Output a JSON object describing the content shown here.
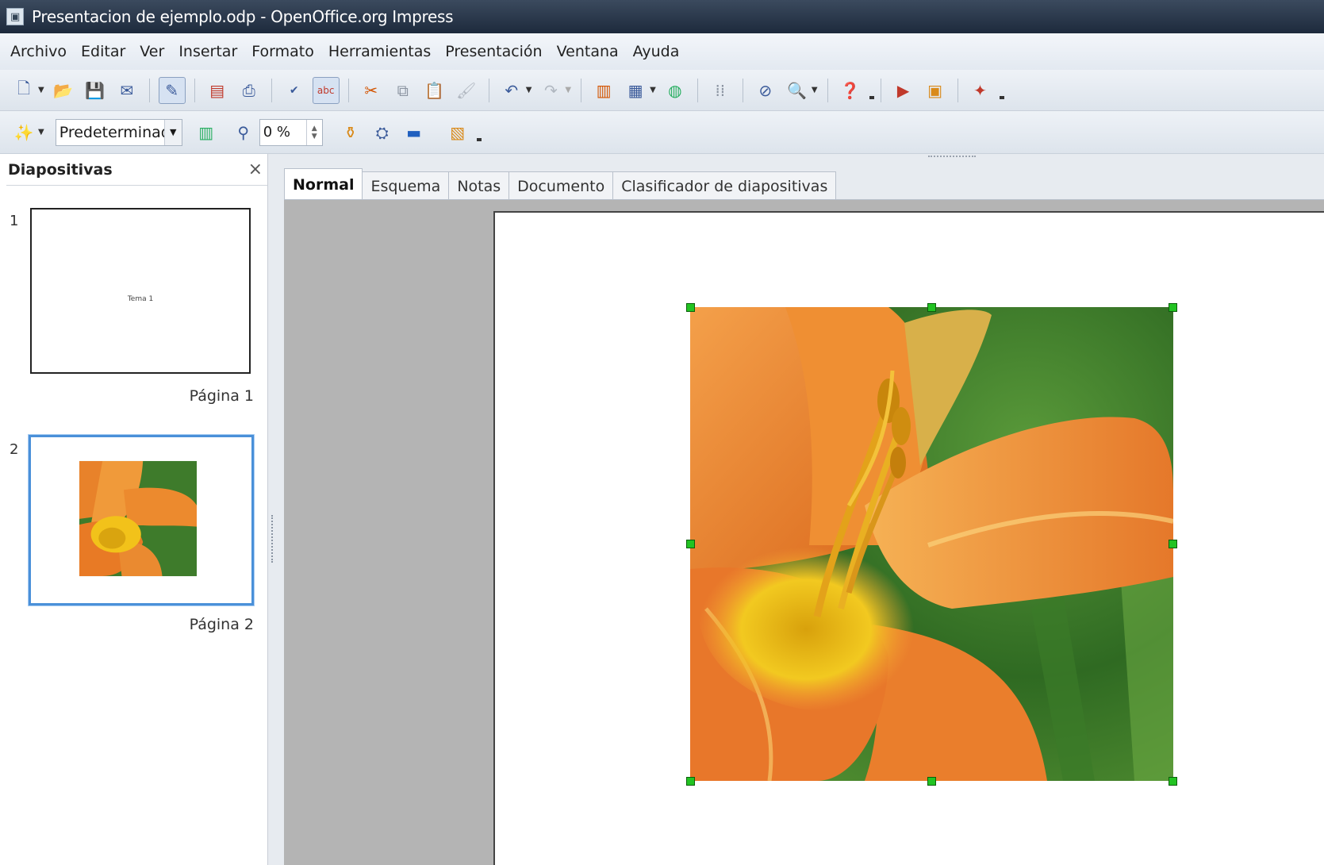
{
  "window": {
    "title": "Presentacion de ejemplo.odp - OpenOffice.org Impress",
    "icon": "impress-doc-icon"
  },
  "menu": {
    "items": [
      "Archivo",
      "Editar",
      "Ver",
      "Insertar",
      "Formato",
      "Herramientas",
      "Presentación",
      "Ventana",
      "Ayuda"
    ]
  },
  "toolbar1": {
    "icons": [
      "new-icon",
      "open-icon",
      "save-icon",
      "email-icon",
      "edit-mode-icon",
      "export-pdf-icon",
      "print-icon",
      "spellcheck-icon",
      "autospell-icon",
      "cut-icon",
      "copy-icon",
      "paste-icon",
      "clone-format-icon",
      "undo-icon",
      "redo-icon",
      "chart-icon",
      "table-icon",
      "color-icon",
      "grid-icon",
      "navigator-icon",
      "zoom-icon",
      "help-icon",
      "slide-show-icon",
      "insert-slide-icon",
      "animation-icon"
    ]
  },
  "toolbar2": {
    "style_value": "Predeterminad",
    "transparency_value": "0 %"
  },
  "slides_pane": {
    "title": "Diapositivas",
    "close_glyph": "×",
    "slides": [
      {
        "number": "1",
        "label": "Página 1",
        "thumb_text": "Tema 1"
      },
      {
        "number": "2",
        "label": "Página 2",
        "thumb_text": ""
      }
    ]
  },
  "view_tabs": [
    {
      "label": "Normal",
      "active": true
    },
    {
      "label": "Esquema",
      "active": false
    },
    {
      "label": "Notas",
      "active": false
    },
    {
      "label": "Documento",
      "active": false
    },
    {
      "label": "Clasificador de diapositivas",
      "active": false
    }
  ],
  "colors": {
    "selection_blue": "#4a90d9",
    "handle_green": "#22c322",
    "workspace_gray": "#b4b4b4"
  }
}
